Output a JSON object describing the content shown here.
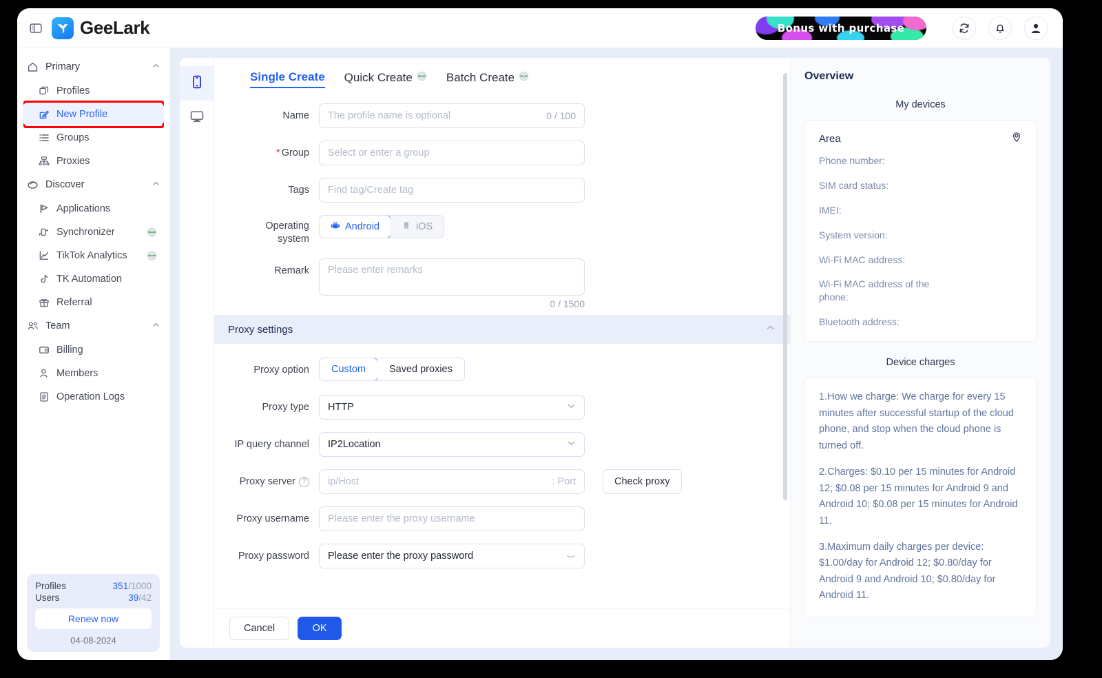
{
  "header": {
    "brand": "GeeLark",
    "panel_toggle_icon": "panel-toggle-icon",
    "promo_banner": "Bonus with purchase",
    "refresh_icon": "refresh-icon",
    "bell_icon": "bell-icon",
    "avatar_icon": "user-avatar-icon"
  },
  "sidebar": {
    "groups": [
      {
        "label": "Primary",
        "icon": "home-icon",
        "items": [
          {
            "label": "Profiles",
            "icon": "profiles-icon",
            "active": false,
            "badge": false
          },
          {
            "label": "New Profile",
            "icon": "edit-square-icon",
            "active": true,
            "badge": false
          },
          {
            "label": "Groups",
            "icon": "list-icon",
            "active": false,
            "badge": false
          },
          {
            "label": "Proxies",
            "icon": "proxy-network-icon",
            "active": false,
            "badge": false
          }
        ]
      },
      {
        "label": "Discover",
        "icon": "compass-icon",
        "items": [
          {
            "label": "Applications",
            "icon": "applications-icon",
            "active": false,
            "badge": false
          },
          {
            "label": "Synchronizer",
            "icon": "synchronizer-icon",
            "active": false,
            "badge": true
          },
          {
            "label": "TikTok Analytics",
            "icon": "analytics-chart-icon",
            "active": false,
            "badge": true
          },
          {
            "label": "TK Automation",
            "icon": "tiktok-note-icon",
            "active": false,
            "badge": false
          },
          {
            "label": "Referral",
            "icon": "gift-icon",
            "active": false,
            "badge": false
          }
        ]
      },
      {
        "label": "Team",
        "icon": "team-people-icon",
        "items": [
          {
            "label": "Billing",
            "icon": "wallet-icon",
            "active": false,
            "badge": false
          },
          {
            "label": "Members",
            "icon": "member-icon",
            "active": false,
            "badge": false
          },
          {
            "label": "Operation Logs",
            "icon": "document-log-icon",
            "active": false,
            "badge": false
          }
        ]
      }
    ],
    "license": {
      "profiles_label": "Profiles",
      "profiles_used": "351",
      "profiles_total": "/1000",
      "users_label": "Users",
      "users_used": "39",
      "users_total": "/42",
      "renew_label": "Renew now",
      "expiry_date": "04-08-2024"
    }
  },
  "rail": {
    "phone_icon": "cloud-phone-icon",
    "desktop_icon": "desktop-monitor-icon"
  },
  "form": {
    "tabs": [
      {
        "label": "Single Create",
        "active": true,
        "badge": false
      },
      {
        "label": "Quick Create",
        "active": false,
        "badge": true
      },
      {
        "label": "Batch Create",
        "active": false,
        "badge": true
      }
    ],
    "name": {
      "label": "Name",
      "placeholder": "The profile name is optional",
      "counter": "0 / 100"
    },
    "group": {
      "label": "Group",
      "required": true,
      "placeholder": "Select or enter a group"
    },
    "tags": {
      "label": "Tags",
      "placeholder": "Find tag/Create tag"
    },
    "os": {
      "label": "Operating\nsystem",
      "options": [
        {
          "label": "Android",
          "icon": "android-icon",
          "selected": true
        },
        {
          "label": "iOS",
          "icon": "apple-ios-icon",
          "selected": false
        }
      ]
    },
    "remark": {
      "label": "Remark",
      "placeholder": "Please enter remarks",
      "counter": "0 / 1500"
    },
    "proxy_section": {
      "title": "Proxy settings",
      "collapse_icon": "chevron-up-icon"
    },
    "proxy_option": {
      "label": "Proxy option",
      "options": [
        {
          "label": "Custom",
          "selected": true
        },
        {
          "label": "Saved proxies",
          "selected": false
        }
      ]
    },
    "proxy_type": {
      "label": "Proxy type",
      "value": "HTTP",
      "caret_icon": "chevron-down-icon"
    },
    "ip_query_channel": {
      "label": "IP query channel",
      "value": "IP2Location",
      "caret_icon": "chevron-down-icon"
    },
    "proxy_server": {
      "label": "Proxy server",
      "help_icon": "question-circle-icon",
      "host_placeholder": "ip/Host",
      "port_placeholder": "Port",
      "separator": ":",
      "check_button": "Check proxy"
    },
    "proxy_username": {
      "label": "Proxy username",
      "placeholder": "Please enter the proxy username"
    },
    "proxy_password": {
      "label": "Proxy password",
      "placeholder": "Please enter the proxy password",
      "eye_icon": "eye-off-icon"
    },
    "footer": {
      "cancel": "Cancel",
      "ok": "OK"
    }
  },
  "overview": {
    "title": "Overview",
    "my_devices_title": "My devices",
    "area_label": "Area",
    "location_icon": "location-pin-icon",
    "device_fields": [
      "Phone number:",
      "SIM card status:",
      "IMEI:",
      "System version:",
      "Wi-Fi MAC address:",
      "Wi-Fi MAC address of the phone:",
      "Bluetooth address:"
    ],
    "device_charges_title": "Device charges",
    "device_charges": [
      "1.How we charge: We charge for every 15 minutes after successful startup of the cloud phone, and stop when the cloud phone is turned off.",
      "2.Charges: $0.10 per 15 minutes for Android 12; $0.08 per 15 minutes for Android 9 and Android 10; $0.08 per 15 minutes for Android 11.",
      "3.Maximum daily charges per device: $1.00/day for Android 12; $0.80/day for Android 9 and Android 10; $0.80/day for Android 11."
    ]
  },
  "colors": {
    "accent": "#2563ef",
    "primary_button": "#2058e8",
    "highlight_box": "#ff0000",
    "panel_bg": "#e7edf9",
    "section_bar": "#e9eefa"
  }
}
